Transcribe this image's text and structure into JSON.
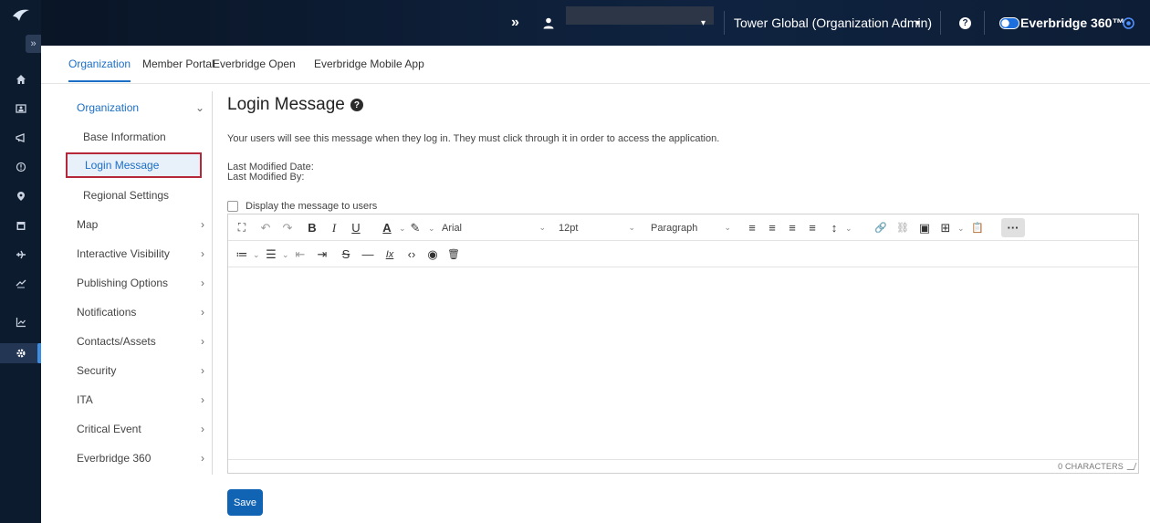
{
  "rail": {
    "icons": [
      "logo-icon",
      "home-icon",
      "contacts-icon",
      "alerts-icon",
      "incidents-icon",
      "location-icon",
      "calendar-icon",
      "travel-icon",
      "trips-icon",
      "analytics-icon",
      "settings-icon"
    ],
    "expand": "»"
  },
  "topbar": {
    "collapse": "»",
    "user_caret": "▾",
    "org": "Tower Global (Organization Admin)",
    "org_caret": "▾",
    "help": "?",
    "brand": "Everbridge 360™"
  },
  "tabs": [
    "Organization",
    "Member Portal",
    "Everbridge Open",
    "Everbridge Mobile App"
  ],
  "leftnav": {
    "section": "Organization",
    "section_chevron": "⌄",
    "subitems": [
      "Base Information",
      "Login Message",
      "Regional Settings"
    ],
    "items": [
      "Map",
      "Interactive Visibility",
      "Publishing Options",
      "Notifications",
      "Contacts/Assets",
      "Security",
      "ITA",
      "Critical Event",
      "Everbridge 360"
    ],
    "chevron": "›"
  },
  "main": {
    "title": "Login Message",
    "title_help": "?",
    "description": "Your users will see this message when they log in. They must click through it in order to access the application.",
    "last_modified_date": "Last Modified Date:",
    "last_modified_by": "Last Modified By:",
    "display_checkbox_label": "Display the message to users",
    "save_label": "Save"
  },
  "editor": {
    "font_family": "Arial",
    "font_size": "12pt",
    "block_format": "Paragraph",
    "char_count": "0 CHARACTERS",
    "toolbar_glyphs": {
      "fullscreen": "⛶",
      "undo": "↶",
      "redo": "↷",
      "bold": "B",
      "italic": "I",
      "underline": "U",
      "text_color": "A",
      "highlight": "✎",
      "align_left": "≡",
      "align_center": "≡",
      "align_right": "≡",
      "justify": "≡",
      "line_height": "↕",
      "link": "🔗",
      "unlink": "⛓",
      "image": "▣",
      "table": "⊞",
      "paste": "📋",
      "more": "···",
      "numbered_list": "≔",
      "bullet_list": "☰",
      "outdent": "⇤",
      "indent": "⇥",
      "strikethrough": "S",
      "horizontal_rule": "—",
      "clear_format": "Ix",
      "source_code": "‹›",
      "preview": "◉",
      "delete": "🗑"
    }
  }
}
